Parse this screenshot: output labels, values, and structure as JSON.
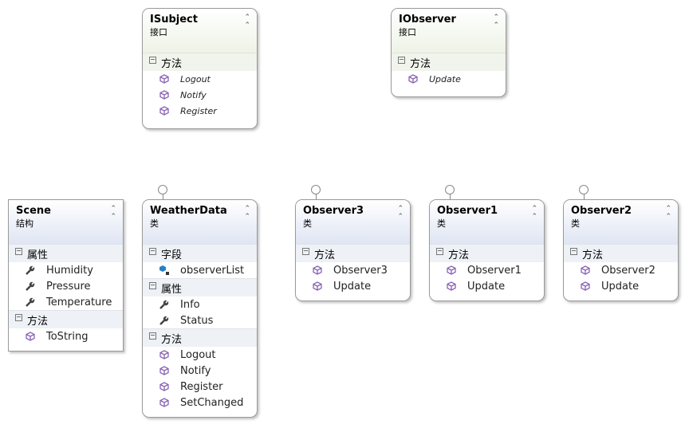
{
  "boxes": [
    {
      "id": "isubject",
      "name": "ISubject",
      "kind": "接口",
      "type": "interface",
      "lollipop": false,
      "sections": [
        {
          "title": "方法",
          "items": [
            {
              "label": "Logout",
              "icon": "method-icon"
            },
            {
              "label": "Notify",
              "icon": "method-icon"
            },
            {
              "label": "Register",
              "icon": "method-icon"
            }
          ]
        }
      ]
    },
    {
      "id": "iobserver",
      "name": "IObserver",
      "kind": "接口",
      "type": "interface",
      "lollipop": false,
      "sections": [
        {
          "title": "方法",
          "items": [
            {
              "label": "Update",
              "icon": "method-icon"
            }
          ]
        }
      ]
    },
    {
      "id": "scene",
      "name": "Scene",
      "kind": "结构",
      "type": "struct",
      "lollipop": false,
      "sections": [
        {
          "title": "属性",
          "items": [
            {
              "label": "Humidity",
              "icon": "property-icon"
            },
            {
              "label": "Pressure",
              "icon": "property-icon"
            },
            {
              "label": "Temperature",
              "icon": "property-icon"
            }
          ]
        },
        {
          "title": "方法",
          "items": [
            {
              "label": "ToString",
              "icon": "method-icon"
            }
          ]
        }
      ]
    },
    {
      "id": "weatherdata",
      "name": "WeatherData",
      "kind": "类",
      "type": "class",
      "lollipop": true,
      "sections": [
        {
          "title": "字段",
          "items": [
            {
              "label": "observerList",
              "icon": "private-field-icon"
            }
          ]
        },
        {
          "title": "属性",
          "items": [
            {
              "label": "Info",
              "icon": "property-icon"
            },
            {
              "label": "Status",
              "icon": "property-icon"
            }
          ]
        },
        {
          "title": "方法",
          "items": [
            {
              "label": "Logout",
              "icon": "method-icon"
            },
            {
              "label": "Notify",
              "icon": "method-icon"
            },
            {
              "label": "Register",
              "icon": "method-icon"
            },
            {
              "label": "SetChanged",
              "icon": "method-icon"
            }
          ]
        }
      ]
    },
    {
      "id": "observer3",
      "name": "Observer3",
      "kind": "类",
      "type": "class",
      "lollipop": true,
      "sections": [
        {
          "title": "方法",
          "items": [
            {
              "label": "Observer3",
              "icon": "method-icon"
            },
            {
              "label": "Update",
              "icon": "method-icon"
            }
          ]
        }
      ]
    },
    {
      "id": "observer1",
      "name": "Observer1",
      "kind": "类",
      "type": "class",
      "lollipop": true,
      "sections": [
        {
          "title": "方法",
          "items": [
            {
              "label": "Observer1",
              "icon": "method-icon"
            },
            {
              "label": "Update",
              "icon": "method-icon"
            }
          ]
        }
      ]
    },
    {
      "id": "observer2",
      "name": "Observer2",
      "kind": "类",
      "type": "class",
      "lollipop": true,
      "sections": [
        {
          "title": "方法",
          "items": [
            {
              "label": "Observer2",
              "icon": "method-icon"
            },
            {
              "label": "Update",
              "icon": "method-icon"
            }
          ]
        }
      ]
    }
  ],
  "colors": {
    "method": "#8a63b5",
    "field": "#2a7fc4",
    "property": "#444444"
  }
}
